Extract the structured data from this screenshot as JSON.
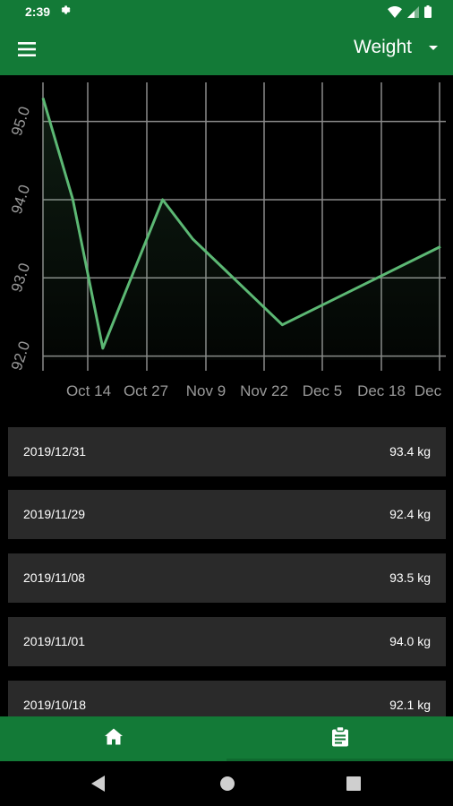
{
  "status_bar": {
    "time": "2:39"
  },
  "app_bar": {
    "title": "Weight"
  },
  "chart_data": {
    "type": "line",
    "x_tick_labels": [
      "Oct 14",
      "Oct 27",
      "Nov 9",
      "Nov 22",
      "Dec 5",
      "Dec 18",
      "Dec"
    ],
    "y_tick_labels": [
      "92.0",
      "93.0",
      "94.0",
      "95.0"
    ],
    "ylim": [
      91.95,
      95.5
    ],
    "x_unit": "days",
    "xlim": [
      0,
      93
    ],
    "points": [
      {
        "date": "2019-09-30",
        "x": 0,
        "y": 95.3
      },
      {
        "date": "2019-10-07",
        "x": 7,
        "y": 94.0
      },
      {
        "date": "2019-10-18",
        "x": 14,
        "y": 92.1
      },
      {
        "date": "2019-11-01",
        "x": 28,
        "y": 94.0
      },
      {
        "date": "2019-11-08",
        "x": 35,
        "y": 93.5
      },
      {
        "date": "2019-11-29",
        "x": 56,
        "y": 92.4
      },
      {
        "date": "2019-12-31",
        "x": 93,
        "y": 93.4
      }
    ],
    "line_color": "#5cb874",
    "grid": true
  },
  "entries": [
    {
      "date": "2019/12/31",
      "value": "93.4 kg"
    },
    {
      "date": "2019/11/29",
      "value": "92.4 kg"
    },
    {
      "date": "2019/11/08",
      "value": "93.5 kg"
    },
    {
      "date": "2019/11/01",
      "value": "94.0 kg"
    },
    {
      "date": "2019/10/18",
      "value": "92.1 kg"
    }
  ],
  "colors": {
    "primary": "#137a37",
    "card": "#2a2a2a",
    "background": "#000000"
  },
  "icons": {
    "bottom_nav": [
      "home-icon",
      "clipboard-icon"
    ],
    "system_nav": [
      "back-icon",
      "home-circle-icon",
      "recents-icon"
    ]
  }
}
